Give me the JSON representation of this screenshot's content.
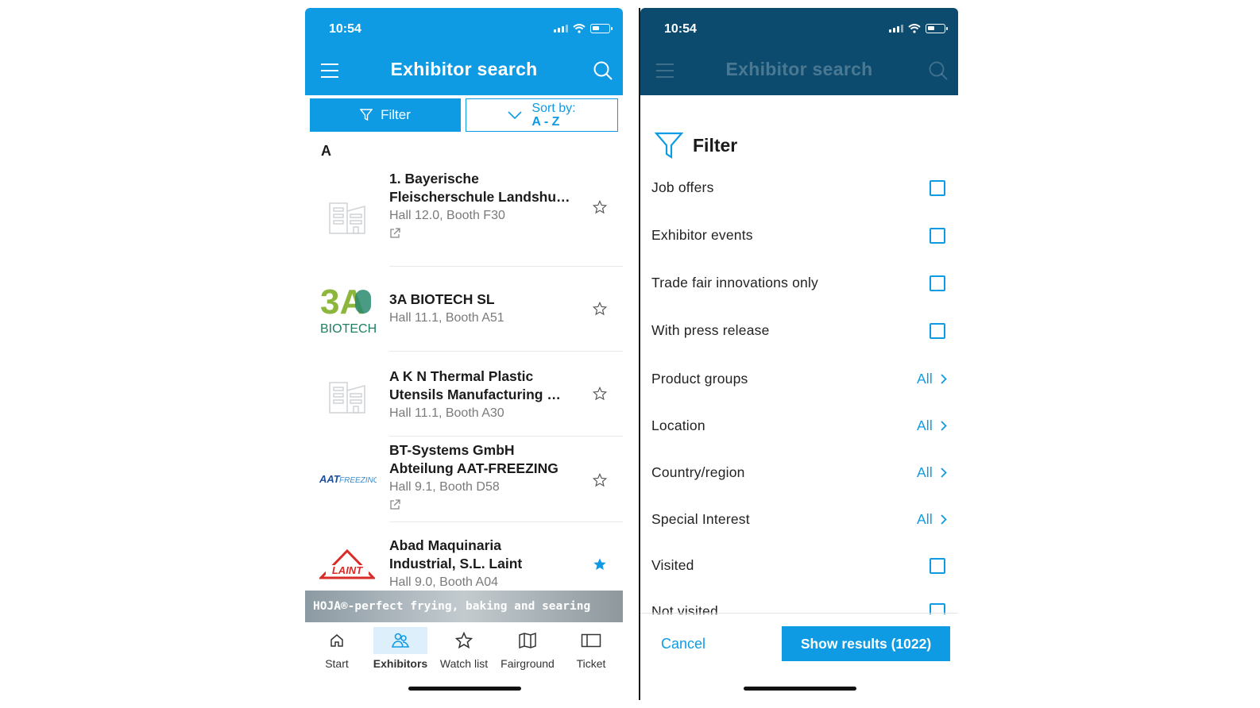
{
  "left": {
    "status_time": "10:54",
    "title": "Exhibitor search",
    "filter_label": "Filter",
    "sort_label": "Sort by:",
    "sort_value": "A - Z",
    "section_letter": "A",
    "exhibitors": [
      {
        "name": "1. Bayerische Fleischerschule Landshu…",
        "booth": "Hall 12.0, Booth F30",
        "logo": "building-placeholder-icon",
        "watched": false,
        "external": true
      },
      {
        "name": "3A BIOTECH SL",
        "booth": "Hall 11.1, Booth A51",
        "logo": "3a-biotech-logo",
        "logo_text_top": "3A",
        "logo_text_bottom": "BIOTECH",
        "watched": false,
        "external": false
      },
      {
        "name": "A K N Thermal Plastic Utensils Manufacturing …",
        "booth": "Hall 11.1, Booth A30",
        "logo": "building-placeholder-icon",
        "watched": false,
        "external": false
      },
      {
        "name": "BT-Systems GmbH Abteilung AAT-FREEZING",
        "booth": "Hall 9.1, Booth D58",
        "logo": "aat-freezing-logo",
        "logo_text_a": "AAT",
        "logo_text_b": "FREEZING",
        "watched": false,
        "external": true
      },
      {
        "name": "Abad Maquinaria Industrial, S.L. Laint",
        "booth": "Hall 9.0, Booth A04",
        "logo": "laint-logo",
        "logo_text": "LAINT",
        "watched": true,
        "external": false
      }
    ],
    "banner": "HOJA®-perfect frying, baking and searing",
    "tabs": [
      {
        "label": "Start",
        "icon": "home-icon"
      },
      {
        "label": "Exhibitors",
        "icon": "exhibitors-icon",
        "active": true
      },
      {
        "label": "Watch list",
        "icon": "star-icon"
      },
      {
        "label": "Fairground",
        "icon": "map-icon"
      },
      {
        "label": "Ticket",
        "icon": "ticket-icon"
      }
    ]
  },
  "right": {
    "status_time": "10:54",
    "title": "Exhibitor search",
    "filter_title": "Filter",
    "options": [
      {
        "label": "Job offers",
        "type": "checkbox"
      },
      {
        "label": "Exhibitor events",
        "type": "checkbox"
      },
      {
        "label": "Trade fair innovations only",
        "type": "checkbox"
      },
      {
        "label": "With press release",
        "type": "checkbox"
      },
      {
        "label": "Product groups",
        "type": "select",
        "value": "All"
      },
      {
        "label": "Location",
        "type": "select",
        "value": "All"
      },
      {
        "label": "Country/region",
        "type": "select",
        "value": "All"
      },
      {
        "label": "Special Interest",
        "type": "select",
        "value": "All"
      },
      {
        "label": "Visited",
        "type": "checkbox"
      },
      {
        "label": "Not visited",
        "type": "checkbox"
      }
    ],
    "cancel_label": "Cancel",
    "show_label": "Show results (1022)"
  },
  "colors": {
    "accent": "#0f9be3",
    "header_dark": "#0d4b6e"
  }
}
